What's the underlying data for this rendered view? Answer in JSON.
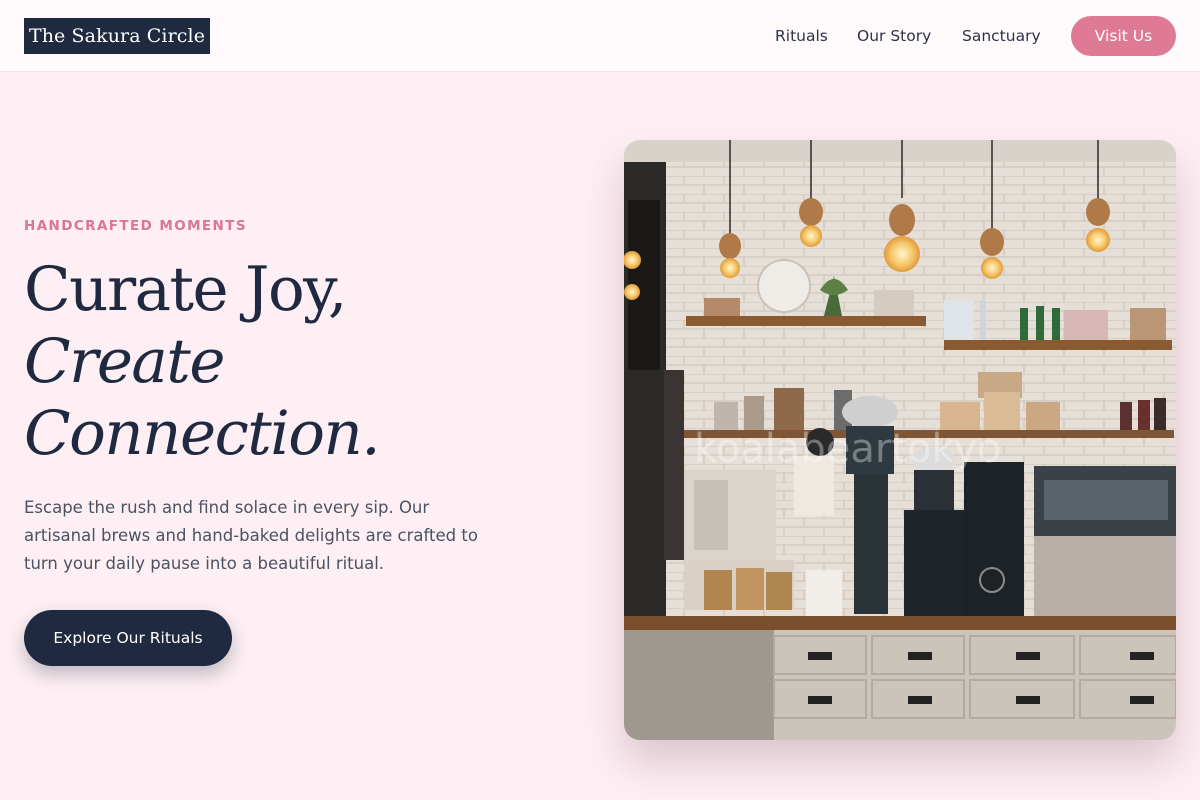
{
  "header": {
    "logo": "The Sakura Circle",
    "nav": [
      "Rituals",
      "Our Story",
      "Sanctuary"
    ],
    "cta": "Visit Us"
  },
  "hero": {
    "eyebrow": "HANDCRAFTED MOMENTS",
    "headline_line1": "Curate Joy,",
    "headline_line2": "Create",
    "headline_line3": "Connection.",
    "body": "Escape the rush and find solace in every sip. Our artisanal brews and hand-baked delights are crafted to turn your daily pause into a beautiful ritual.",
    "cta": "Explore Our Rituals",
    "image_watermark": "koalabeartokyo"
  },
  "colors": {
    "background": "#fdeff3",
    "navy": "#1f2a40",
    "pink": "#de7996",
    "eyebrow": "#d87693"
  }
}
